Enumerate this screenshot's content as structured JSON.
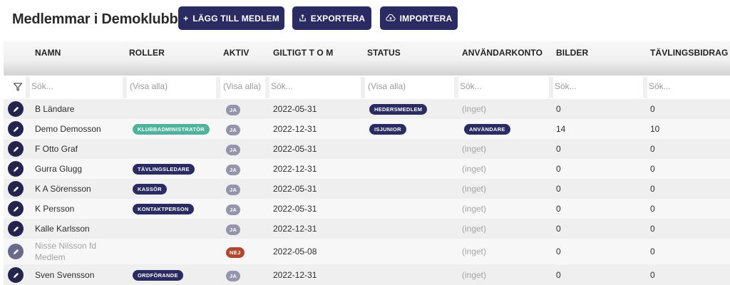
{
  "header": {
    "title": "Medlemmar i Demoklubben",
    "buttons": [
      {
        "label": "LÄGG TILL MEDLEM",
        "icon": "plus-icon"
      },
      {
        "label": "EXPORTERA",
        "icon": "export-icon"
      },
      {
        "label": "IMPORTERA",
        "icon": "cloud-upload-icon"
      }
    ]
  },
  "table": {
    "columns": [
      "NAMN",
      "ROLLER",
      "AKTIV",
      "GILTIGT T O M",
      "STATUS",
      "ANVÄNDARKONTO",
      "BILDER",
      "TÄVLINGSBIDRAG"
    ],
    "filters": {
      "name": "Sök...",
      "roles": "(Visa alla)",
      "active": "(Visa alla)",
      "valid": "Sök...",
      "status": "(Visa alla)",
      "account": "Sök...",
      "images": "Sök...",
      "entries": "Sök..."
    },
    "rows": [
      {
        "name": "B Ländare",
        "role": "",
        "active": "JA",
        "valid": "2022-05-31",
        "status": "HEDERSMEDLEM",
        "account": "(inget)",
        "images": "0",
        "entries": "0"
      },
      {
        "name": "Demo Demosson",
        "role": "KLUBBADMINISTRATÖR",
        "active": "JA",
        "valid": "2022-12-31",
        "status": "ISJUNIOR",
        "account": "ANVÄNDARE",
        "images": "14",
        "entries": "10"
      },
      {
        "name": "F Otto Graf",
        "role": "",
        "active": "JA",
        "valid": "2022-05-31",
        "status": "",
        "account": "(inget)",
        "images": "0",
        "entries": "0"
      },
      {
        "name": "Gurra Glugg",
        "role": "TÄVLINGSLEDARE",
        "active": "JA",
        "valid": "2022-12-31",
        "status": "",
        "account": "(inget)",
        "images": "0",
        "entries": "0"
      },
      {
        "name": "K A Sörensson",
        "role": "KASSÖR",
        "active": "JA",
        "valid": "2022-05-31",
        "status": "",
        "account": "(inget)",
        "images": "0",
        "entries": "0"
      },
      {
        "name": "K Persson",
        "role": "KONTAKTPERSON",
        "active": "JA",
        "valid": "2022-05-31",
        "status": "",
        "account": "(inget)",
        "images": "0",
        "entries": "0"
      },
      {
        "name": "Kalle Karlsson",
        "role": "",
        "active": "JA",
        "valid": "2022-12-31",
        "status": "",
        "account": "(inget)",
        "images": "0",
        "entries": "0"
      },
      {
        "name_line1": "Nisse Nilsson fd",
        "name_line2": "Medlem",
        "role": "",
        "active": "NEJ",
        "valid": "2022-05-08",
        "status": "",
        "account": "(inget)",
        "images": "0",
        "entries": "0"
      },
      {
        "name": "Sven Svensson",
        "role": "ORDFÖRANDE",
        "active": "JA",
        "valid": "2022-12-31",
        "status": "",
        "account": "(inget)",
        "images": "0",
        "entries": "0"
      }
    ]
  }
}
